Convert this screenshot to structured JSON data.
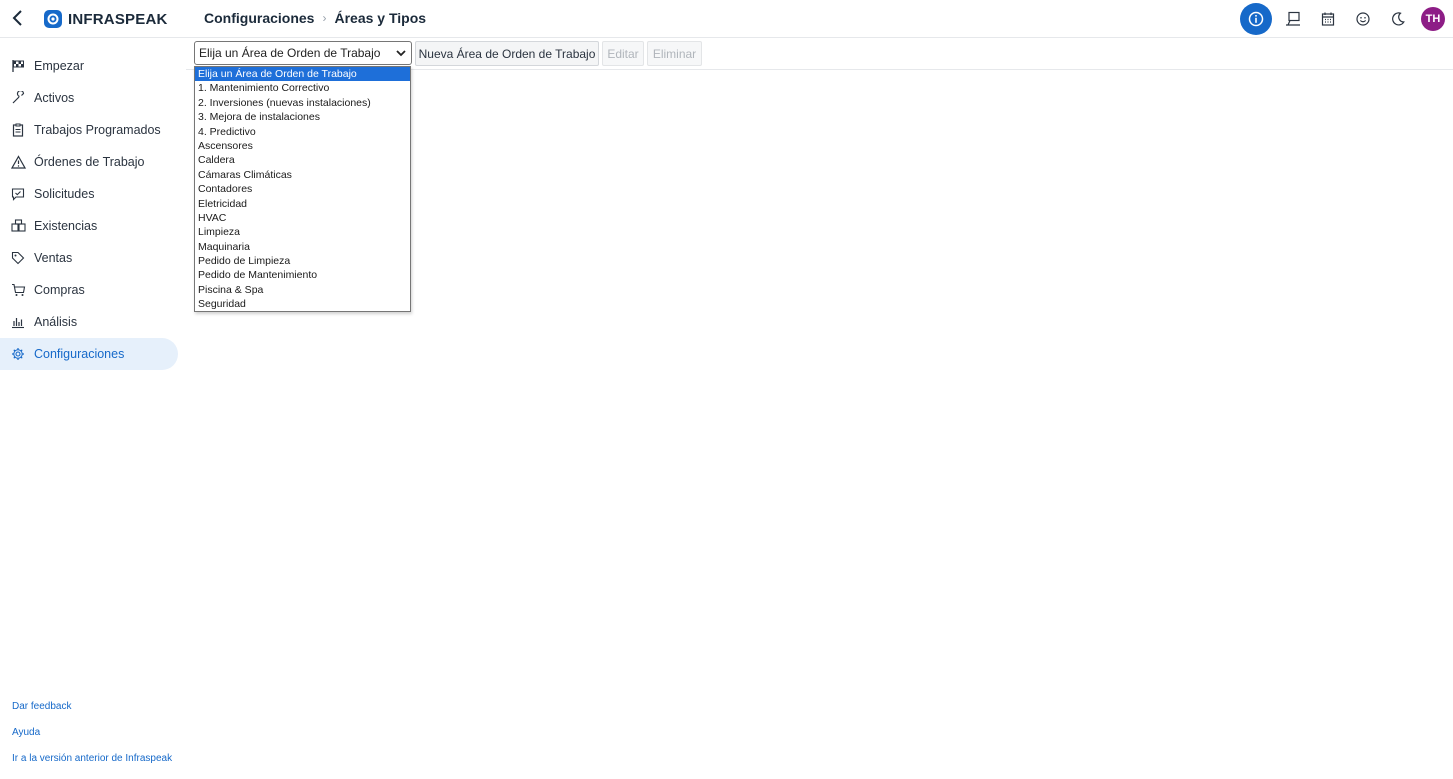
{
  "header": {
    "logo_text": "INFRASPEAK",
    "breadcrumb_parent": "Configuraciones",
    "breadcrumb_separator": "›",
    "breadcrumb_current": "Áreas y Tipos",
    "avatar_initials": "TH",
    "icons": [
      "back-arrow-icon",
      "info-icon",
      "kiosk-icon",
      "calendar-icon",
      "smiley-icon",
      "moon-icon"
    ]
  },
  "sidebar": {
    "items": [
      {
        "label": "Empezar",
        "icon": "checkered-flag-icon"
      },
      {
        "label": "Activos",
        "icon": "wrench-icon"
      },
      {
        "label": "Trabajos Programados",
        "icon": "clipboard-icon"
      },
      {
        "label": "Órdenes de Trabajo",
        "icon": "warning-icon"
      },
      {
        "label": "Solicitudes",
        "icon": "message-check-icon"
      },
      {
        "label": "Existencias",
        "icon": "boxes-icon"
      },
      {
        "label": "Ventas",
        "icon": "tag-icon"
      },
      {
        "label": "Compras",
        "icon": "cart-icon"
      },
      {
        "label": "Análisis",
        "icon": "bar-chart-icon"
      },
      {
        "label": "Configuraciones",
        "icon": "gear-icon"
      }
    ],
    "active_index": 9,
    "footer_links": [
      "Dar feedback",
      "Ayuda",
      "Ir a la versión anterior de Infraspeak"
    ]
  },
  "toolbar": {
    "select_value": "Elija un Área de Orden de Trabajo",
    "new_button": "Nueva Área de Orden de Trabajo",
    "edit_button": "Editar",
    "delete_button": "Eliminar"
  },
  "dropdown": {
    "options": [
      "Elija un Área de Orden de Trabajo",
      "1. Mantenimiento Correctivo",
      "2. Inversiones (nuevas instalaciones)",
      "3. Mejora de instalaciones",
      "4. Predictivo",
      "Ascensores",
      "Caldera",
      "Cámaras Climáticas",
      "Contadores",
      "Eletricidad",
      "HVAC",
      "Limpieza",
      "Maquinaria",
      "Pedido de Limpieza",
      "Pedido de Mantenimiento",
      "Piscina & Spa",
      "Seguridad"
    ],
    "selected_index": 0
  },
  "colors": {
    "accent": "#1669c9",
    "avatar": "#8d1d86",
    "active_nav_bg": "#e6f0fb",
    "option_highlight": "#1e6fd9"
  }
}
